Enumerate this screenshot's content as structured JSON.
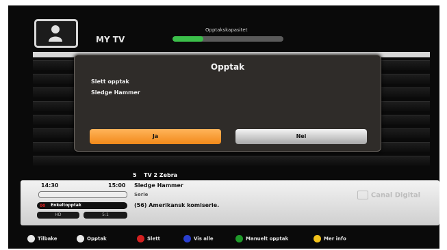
{
  "header": {
    "title": "MY TV",
    "capacity_label": "Opptakskapasitet",
    "capacity_fraction": 0.28
  },
  "dialog": {
    "title": "Opptak",
    "line1": "Slett opptak",
    "line2": "Sledge Hammer",
    "yes_label": "Ja",
    "no_label": "Nei"
  },
  "channel": {
    "number": "5",
    "name": "TV 2 Zebra"
  },
  "info": {
    "start": "14:30",
    "end": "15:00",
    "title": "Sledge Hammer",
    "genre": "Serie",
    "description": "(56) Amerikansk komiserie.",
    "rec_badge": "00",
    "rec_label": "Enkeltopptak",
    "quality": "HD",
    "aspect": "5:1",
    "brand": "Canal Digital"
  },
  "legend": [
    {
      "label": "Tilbake",
      "icon": "back-icon",
      "color": "#e8e8e8"
    },
    {
      "label": "Opptak",
      "icon": "record-icon",
      "color": "#e8e8e8"
    },
    {
      "label": "Slett",
      "icon": "red-button-icon",
      "color": "#d42020"
    },
    {
      "label": "Vis alle",
      "icon": "blue-button-icon",
      "color": "#2a3fd0"
    },
    {
      "label": "Manuelt opptak",
      "icon": "green-button-icon",
      "color": "#1f9a2a"
    },
    {
      "label": "Mer info",
      "icon": "yellow-button-icon",
      "color": "#f2c21a"
    }
  ]
}
